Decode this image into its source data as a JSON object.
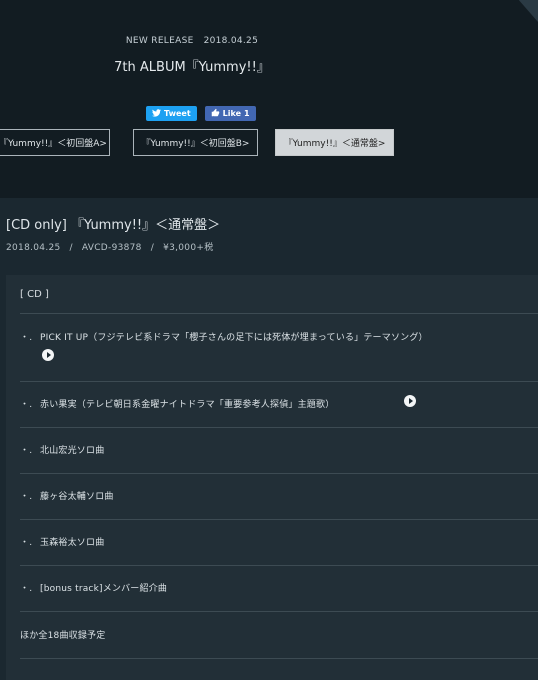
{
  "header": {
    "release_label": "NEW RELEASE",
    "release_date": "2018.04.25",
    "album_title": "7th ALBUM『Yummy!!』"
  },
  "social": {
    "tweet_label": "Tweet",
    "like_label": "Like",
    "like_count": "1"
  },
  "editions": [
    {
      "label": "『Yummy!!』＜初回盤A>"
    },
    {
      "label": "『Yummy!!』＜初回盤B>"
    },
    {
      "label": "『Yummy!!』＜通常盤>"
    }
  ],
  "product": {
    "title": "[CD only] 『Yummy!!』＜通常盤＞",
    "date": "2018.04.25",
    "sep": "/",
    "catalog": "AVCD-93878",
    "price": "¥3,000+税"
  },
  "tracklist": {
    "disc_label": "[ CD ]",
    "bullet": "・.",
    "tracks": [
      {
        "title": "PICK IT UP（フジテレビ系ドラマ「櫻子さんの足下には死体が埋まっている」テーマソング）"
      },
      {
        "title": "赤い果実（テレビ朝日系金曜ナイトドラマ「重要参考人探偵」主題歌）"
      },
      {
        "title": "北山宏光ソロ曲"
      },
      {
        "title": "藤ヶ谷太輔ソロ曲"
      },
      {
        "title": "玉森裕太ソロ曲"
      },
      {
        "title": "[bonus track]メンバー紹介曲"
      }
    ],
    "note": "ほか全18曲収録予定"
  },
  "colors": {
    "background": "#1b2830",
    "header_bg": "#121c22",
    "panel_bg": "#222f37",
    "twitter": "#1da1f2",
    "facebook": "#4267b2",
    "active_tab": "#d2d6d9"
  }
}
